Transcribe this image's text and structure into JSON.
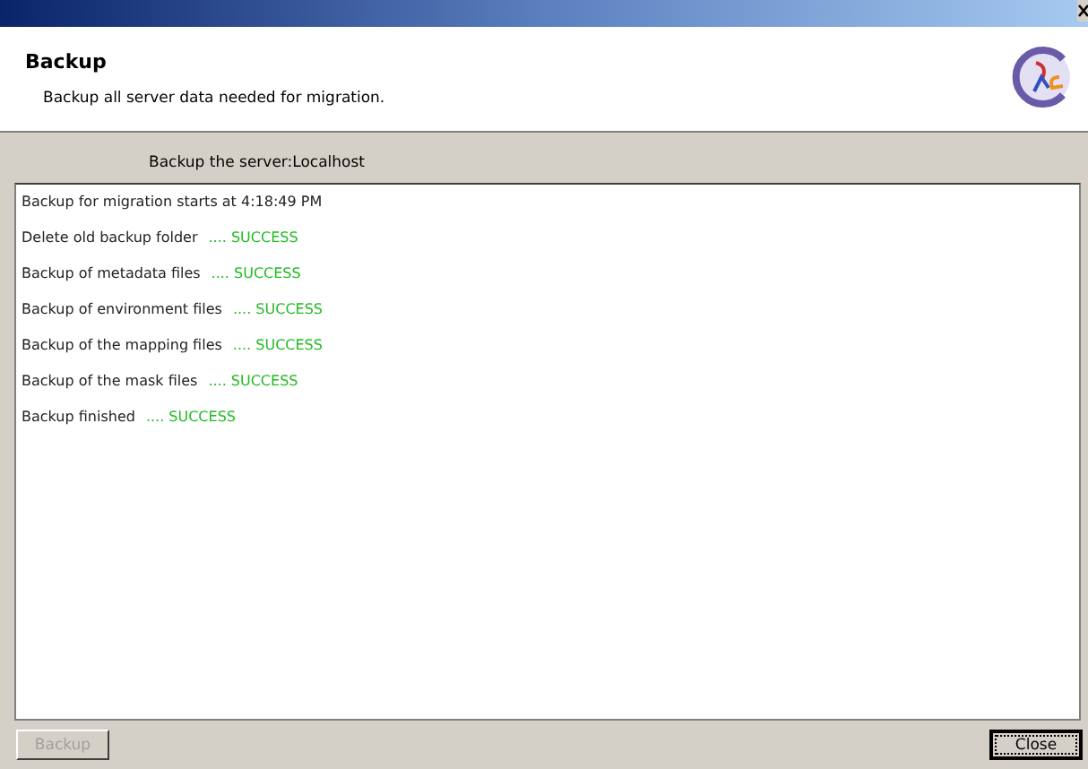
{
  "header": {
    "title": "Backup",
    "subtitle": "Backup all server data needed for migration."
  },
  "server_label": "Backup the server:Localhost",
  "log": [
    {
      "message": "Backup for migration starts at 4:18:49 PM"
    },
    {
      "message": "Delete old backup folder",
      "status": ".... SUCCESS"
    },
    {
      "message": "Backup of metadata files",
      "status": ".... SUCCESS"
    },
    {
      "message": "Backup of environment files",
      "status": ".... SUCCESS"
    },
    {
      "message": "Backup of the mapping files",
      "status": ".... SUCCESS"
    },
    {
      "message": "Backup of the mask files",
      "status": ".... SUCCESS"
    },
    {
      "message": "Backup finished",
      "status": ".... SUCCESS"
    }
  ],
  "buttons": [
    {
      "label": "Backup",
      "disabled": true,
      "focused": false
    },
    {
      "label": "Close",
      "disabled": false,
      "focused": true
    }
  ]
}
